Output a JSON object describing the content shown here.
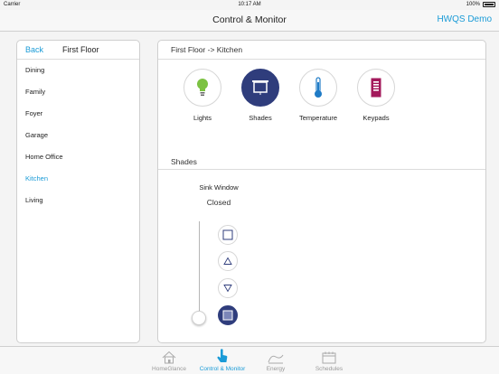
{
  "status_bar": {
    "carrier": "Carrier",
    "time": "10:17 AM",
    "battery": "100%"
  },
  "nav": {
    "title": "Control & Monitor",
    "right_link": "HWQS Demo"
  },
  "sidebar": {
    "back_label": "Back",
    "floor_title": "First Floor",
    "rooms": [
      "Dining",
      "Family",
      "Foyer",
      "Garage",
      "Home Office",
      "Kitchen",
      "Living"
    ],
    "selected_room": "Kitchen"
  },
  "main": {
    "breadcrumb": "First Floor -> Kitchen",
    "devices": [
      {
        "label": "Lights",
        "icon": "lightbulb-icon"
      },
      {
        "label": "Shades",
        "icon": "shade-icon",
        "selected": true
      },
      {
        "label": "Temperature",
        "icon": "thermometer-icon"
      },
      {
        "label": "Keypads",
        "icon": "keypad-icon"
      }
    ],
    "section_title": "Shades",
    "shade": {
      "name": "Sink Window",
      "status": "Closed",
      "level": 0,
      "controls": [
        "shade-open-icon",
        "raise-icon",
        "lower-icon",
        "shade-closed-icon"
      ]
    }
  },
  "tabs": [
    {
      "label": "HomeGlance",
      "icon": "home-icon"
    },
    {
      "label": "Control & Monitor",
      "icon": "hand-pointer-icon",
      "active": true
    },
    {
      "label": "Energy",
      "icon": "energy-icon"
    },
    {
      "label": "Schedules",
      "icon": "calendar-icon"
    }
  ],
  "colors": {
    "accent": "#1a9bd7",
    "selected_fill": "#2f3d7c",
    "light_green": "#7cc242",
    "thermo_blue": "#1f7bc6",
    "keypad_magenta": "#a3195b"
  }
}
